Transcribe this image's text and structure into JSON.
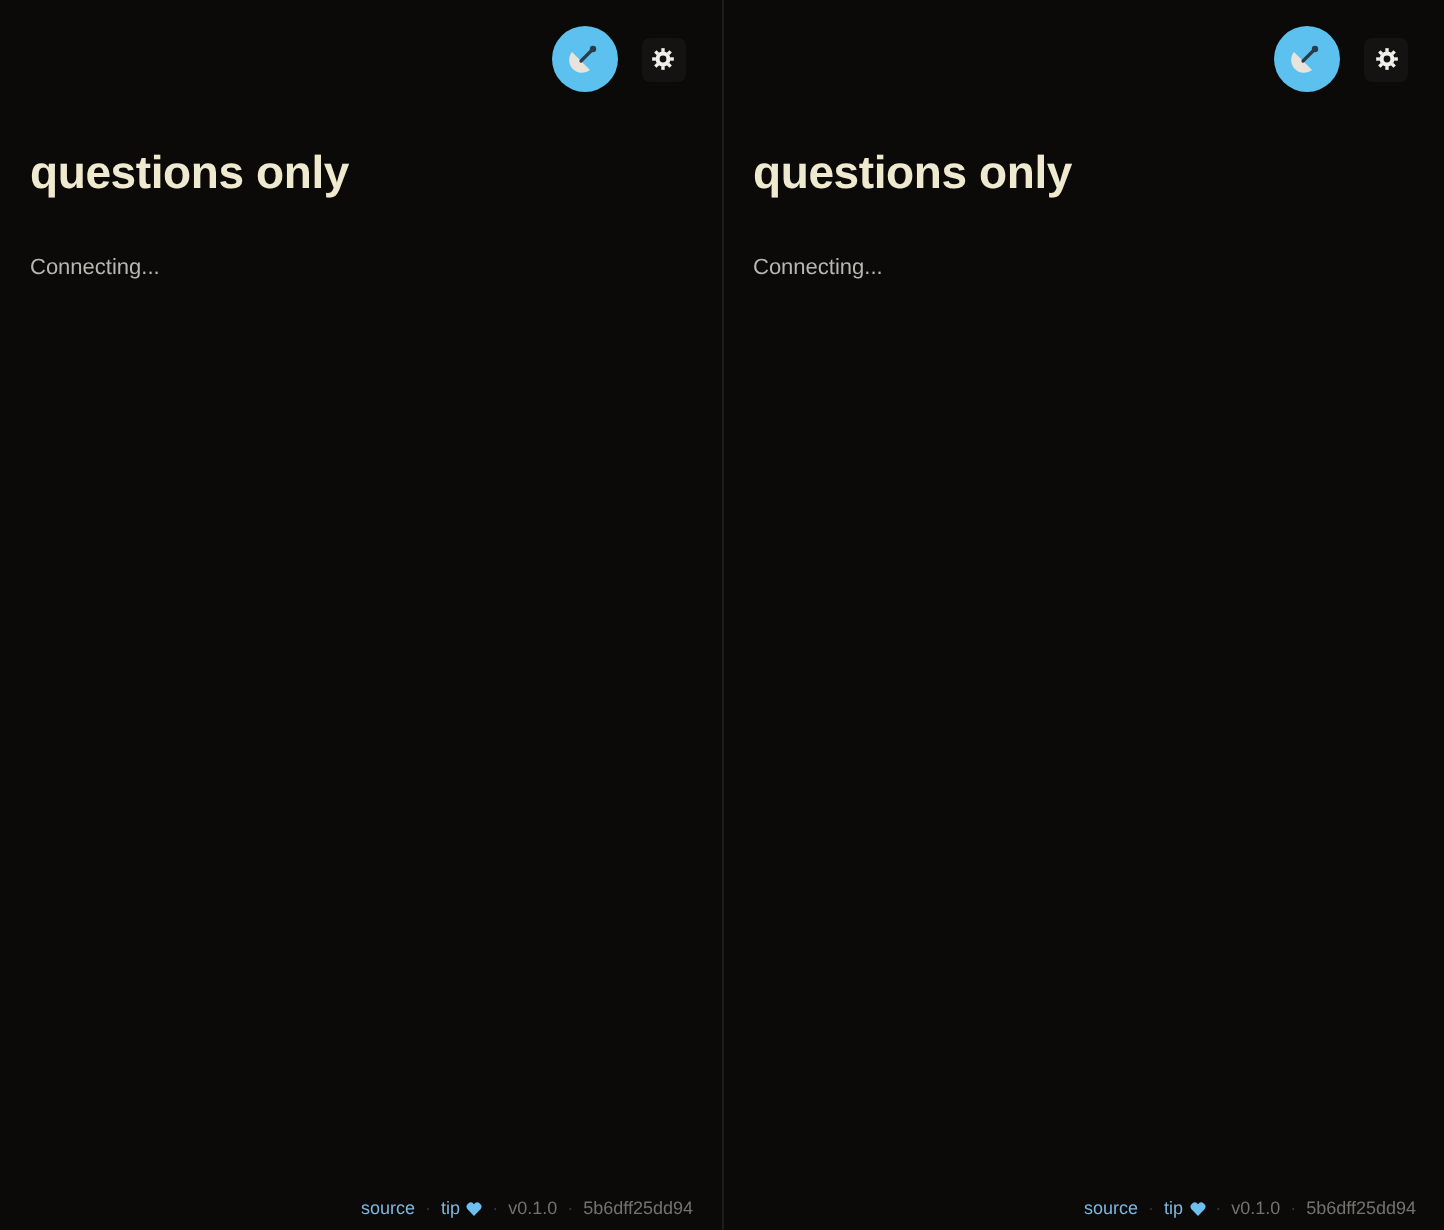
{
  "panels": [
    {
      "title": "questions only",
      "status": "Connecting...",
      "footer": [
        {
          "kind": "link",
          "text": "source"
        },
        {
          "kind": "separator",
          "text": "·"
        },
        {
          "kind": "donate",
          "text": "tip"
        },
        {
          "kind": "separator",
          "text": "·"
        },
        {
          "kind": "version",
          "text": "v0.1.0"
        },
        {
          "kind": "separator",
          "text": "·"
        },
        {
          "kind": "commit",
          "text": "5b6dff25dd94"
        }
      ]
    },
    {
      "title": "questions only",
      "status": "Connecting...",
      "footer": [
        {
          "kind": "link",
          "text": "source"
        },
        {
          "kind": "separator",
          "text": "·"
        },
        {
          "kind": "donate",
          "text": "tip"
        },
        {
          "kind": "separator",
          "text": "·"
        },
        {
          "kind": "version",
          "text": "v0.1.0"
        },
        {
          "kind": "separator",
          "text": "·"
        },
        {
          "kind": "commit",
          "text": "5b6dff25dd94"
        }
      ]
    }
  ]
}
